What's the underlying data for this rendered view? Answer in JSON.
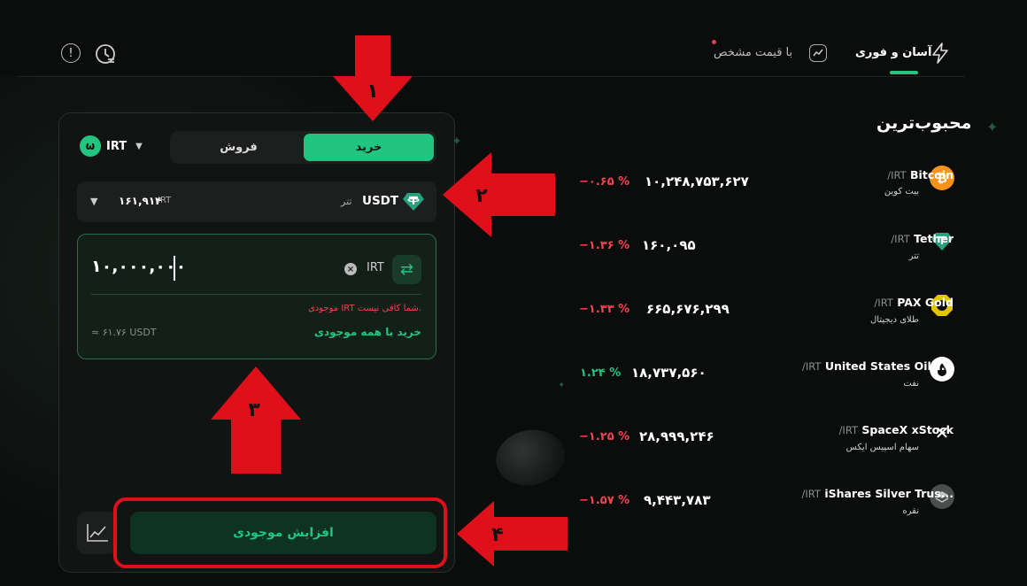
{
  "header": {
    "tab_instant": "آسان و فوری",
    "tab_limit": "با قیمت مشخص",
    "limit_dot_color": "#e0404a",
    "icons": [
      "info-icon",
      "history-icon",
      "chart-trend-icon",
      "lightning-icon"
    ]
  },
  "trade": {
    "buy_label": "خرید",
    "sell_label": "فروش",
    "currency": "IRT",
    "asset_symbol": "USDT",
    "asset_name": "تتر",
    "asset_price": "۱۶۱,۹۱۴",
    "asset_price_unit": "IRT",
    "amount_value": "۱۰,۰۰۰,۰۰۰",
    "amount_unit": "IRT",
    "error": "موجودی IRT شما کافی نیست.",
    "buy_all": "خرید با همه موجودی",
    "estimate": "≈ ۶۱.۷۶ USDT",
    "deposit_button": "افزایش موجودی"
  },
  "annotations": [
    "۱",
    "۲",
    "۳",
    "۴"
  ],
  "popular": {
    "title": "محبوب‌ترین",
    "items": [
      {
        "name": "Bitcoin",
        "quote": "/IRT",
        "sub": "بیت کوین",
        "price": "۱۰,۲۴۸,۷۵۳,۶۲۷",
        "change": "−۰.۶۵ %",
        "dir": "neg",
        "icon": "bitcoin-icon"
      },
      {
        "name": "Tether",
        "quote": "/IRT",
        "sub": "تتر",
        "price": "۱۶۰,۰۹۵",
        "change": "−۱.۳۶ %",
        "dir": "neg",
        "icon": "tether-icon"
      },
      {
        "name": "PAX Gold",
        "quote": "/IRT",
        "sub": "طلای دیجیتال",
        "price": "۶۶۵,۶۷۶,۲۹۹",
        "change": "−۱.۳۳ %",
        "dir": "neg",
        "icon": "pax-gold-icon"
      },
      {
        "name": "United States Oil T...",
        "quote": "/IRT",
        "sub": "نفت",
        "price": "۱۸,۷۳۷,۵۶۰",
        "change": "۱.۲۴ %",
        "dir": "pos",
        "icon": "oil-drop-icon"
      },
      {
        "name": "SpaceX xStock",
        "quote": "/IRT",
        "sub": "سهام اسپیس ایکس",
        "price": "۲۸,۹۹۹,۲۴۶",
        "change": "−۱.۲۵ %",
        "dir": "neg",
        "icon": "spacex-icon"
      },
      {
        "name": "iShares Silver Trus...",
        "quote": "/IRT",
        "sub": "نقره",
        "price": "۹,۴۴۳,۷۸۳",
        "change": "−۱.۵۷ %",
        "dir": "neg",
        "icon": "silver-icon"
      }
    ]
  }
}
